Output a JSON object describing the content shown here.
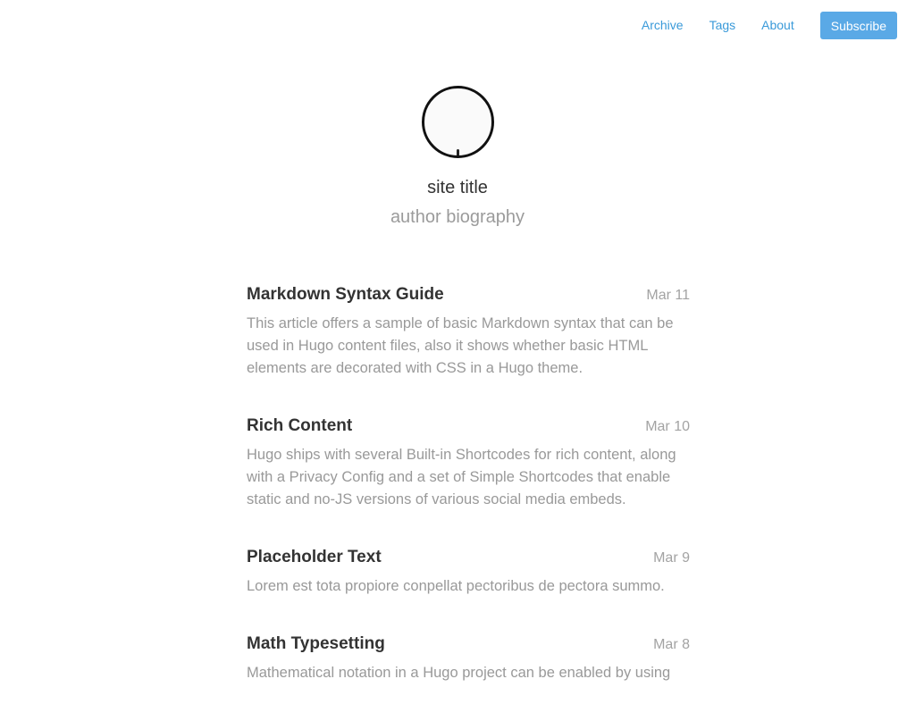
{
  "nav": {
    "links": [
      "Archive",
      "Tags",
      "About"
    ],
    "subscribe_label": "Subscribe",
    "accent_color": "#5aa9e6",
    "link_color": "#3a9ad9"
  },
  "profile": {
    "site_title": "site title",
    "bio": "author biography"
  },
  "posts": [
    {
      "title": "Markdown Syntax Guide",
      "date": "Mar 11",
      "summary": "This article offers a sample of basic Markdown syntax that can be used in Hugo content files, also it shows whether basic HTML elements are decorated with CSS in a Hugo theme."
    },
    {
      "title": "Rich Content",
      "date": "Mar 10",
      "summary": "Hugo ships with several Built-in Shortcodes for rich content, along with a Privacy Config and a set of Simple Shortcodes that enable static and no-JS versions of various social media embeds."
    },
    {
      "title": "Placeholder Text",
      "date": "Mar 9",
      "summary": "Lorem est tota propiore conpellat pectoribus de pectora summo."
    },
    {
      "title": "Math Typesetting",
      "date": "Mar 8",
      "summary": "Mathematical notation in a Hugo project can be enabled by using"
    }
  ]
}
